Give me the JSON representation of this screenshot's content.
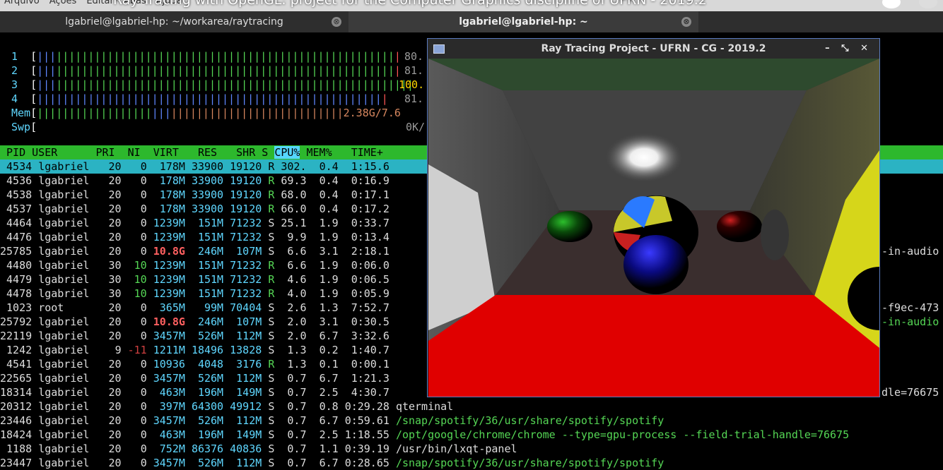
{
  "top_menu": [
    "Arquivo",
    "Ações",
    "Editar",
    "Abas",
    "Ajuda"
  ],
  "video_title": "Ray Tracing with OpenGL: project for the Computer Graphics discipline of UFRN - 2019.2",
  "tabs": [
    {
      "label": "lgabriel@lgabriel-hp: ~/workarea/raytracing",
      "close": "⊗"
    },
    {
      "label": "lgabriel@lgabriel-hp: ~",
      "close": "⊗"
    }
  ],
  "meters": {
    "cpu": [
      {
        "num": "1",
        "pct": "80."
      },
      {
        "num": "2",
        "pct": "81."
      },
      {
        "num": "3",
        "pct": "100."
      },
      {
        "num": "4",
        "pct": "81."
      }
    ],
    "mem": {
      "label": "Mem",
      "value": "2.38G/7.6"
    },
    "swp": {
      "label": "Swp",
      "value": "0K/"
    }
  },
  "table": {
    "header": " PID USER      PRI  NI  VIRT   RES   SHR S CPU% MEM%   TIME+",
    "sort_col": "CPU%",
    "rows": [
      {
        "pid": " 4534",
        "user": "lgabriel",
        "pri": "20",
        "ni": "0",
        "virt": "178M",
        "res": "33900",
        "shr": "19120",
        "s": "R",
        "cpu": "302.",
        "mem": "0.4",
        "time": "1:15.6",
        "cmd": "",
        "sel": true
      },
      {
        "pid": " 4536",
        "user": "lgabriel",
        "pri": "20",
        "ni": "0",
        "virt": "178M",
        "res": "33900",
        "shr": "19120",
        "s": "R",
        "cpu": "69.3",
        "mem": "0.4",
        "time": "0:16.9",
        "cmd": ""
      },
      {
        "pid": " 4538",
        "user": "lgabriel",
        "pri": "20",
        "ni": "0",
        "virt": "178M",
        "res": "33900",
        "shr": "19120",
        "s": "R",
        "cpu": "68.0",
        "mem": "0.4",
        "time": "0:17.1",
        "cmd": ""
      },
      {
        "pid": " 4537",
        "user": "lgabriel",
        "pri": "20",
        "ni": "0",
        "virt": "178M",
        "res": "33900",
        "shr": "19120",
        "s": "R",
        "cpu": "66.0",
        "mem": "0.4",
        "time": "0:17.2",
        "cmd": ""
      },
      {
        "pid": " 4464",
        "user": "lgabriel",
        "pri": "20",
        "ni": "0",
        "virt": "1239M",
        "res": "151M",
        "shr": "71232",
        "s": "S",
        "cpu": "25.1",
        "mem": "1.9",
        "time": "0:33.7",
        "cmd": ""
      },
      {
        "pid": " 4476",
        "user": "lgabriel",
        "pri": "20",
        "ni": "0",
        "virt": "1239M",
        "res": "151M",
        "shr": "71232",
        "s": "S",
        "cpu": "9.9",
        "mem": "1.9",
        "time": "0:13.4",
        "cmd": ""
      },
      {
        "pid": "25785",
        "user": "lgabriel",
        "pri": "20",
        "ni": "0",
        "virt": "10.8G",
        "res": "246M",
        "shr": "107M",
        "s": "S",
        "cpu": "6.6",
        "mem": "3.1",
        "time": "2:18.1",
        "cmd": "",
        "bigvirt": true
      },
      {
        "pid": " 4480",
        "user": "lgabriel",
        "pri": "30",
        "ni": "10",
        "virt": "1239M",
        "res": "151M",
        "shr": "71232",
        "s": "R",
        "cpu": "6.6",
        "mem": "1.9",
        "time": "0:06.0",
        "cmd": ""
      },
      {
        "pid": " 4479",
        "user": "lgabriel",
        "pri": "30",
        "ni": "10",
        "virt": "1239M",
        "res": "151M",
        "shr": "71232",
        "s": "R",
        "cpu": "4.6",
        "mem": "1.9",
        "time": "0:06.5",
        "cmd": ""
      },
      {
        "pid": " 4478",
        "user": "lgabriel",
        "pri": "30",
        "ni": "10",
        "virt": "1239M",
        "res": "151M",
        "shr": "71232",
        "s": "R",
        "cpu": "4.0",
        "mem": "1.9",
        "time": "0:05.9",
        "cmd": ""
      },
      {
        "pid": " 1023",
        "user": "root",
        "pri": "20",
        "ni": "0",
        "virt": "365M",
        "res": "99M",
        "shr": "70404",
        "s": "S",
        "cpu": "2.6",
        "mem": "1.3",
        "time": "7:52.7",
        "cmd": ""
      },
      {
        "pid": "25792",
        "user": "lgabriel",
        "pri": "20",
        "ni": "0",
        "virt": "10.8G",
        "res": "246M",
        "shr": "107M",
        "s": "S",
        "cpu": "2.0",
        "mem": "3.1",
        "time": "0:30.5",
        "cmd": "",
        "bigvirt": true
      },
      {
        "pid": "22119",
        "user": "lgabriel",
        "pri": "20",
        "ni": "0",
        "virt": "3457M",
        "res": "526M",
        "shr": "112M",
        "s": "S",
        "cpu": "2.0",
        "mem": "6.7",
        "time": "3:32.6",
        "cmd": ""
      },
      {
        "pid": " 1242",
        "user": "lgabriel",
        "pri": "9",
        "ni": "-11",
        "virt": "1211M",
        "res": "18496",
        "shr": "13828",
        "s": "S",
        "cpu": "1.3",
        "mem": "0.2",
        "time": "1:40.7",
        "cmd": ""
      },
      {
        "pid": " 4541",
        "user": "lgabriel",
        "pri": "20",
        "ni": "0",
        "virt": "10936",
        "res": "4048",
        "shr": "3176",
        "s": "R",
        "cpu": "1.3",
        "mem": "0.1",
        "time": "0:00.1",
        "cmd": ""
      },
      {
        "pid": "22565",
        "user": "lgabriel",
        "pri": "20",
        "ni": "0",
        "virt": "3457M",
        "res": "526M",
        "shr": "112M",
        "s": "S",
        "cpu": "0.7",
        "mem": "6.7",
        "time": "1:21.3",
        "cmd": ""
      },
      {
        "pid": "18314",
        "user": "lgabriel",
        "pri": "20",
        "ni": "0",
        "virt": "463M",
        "res": "196M",
        "shr": "149M",
        "s": "S",
        "cpu": "0.7",
        "mem": "2.5",
        "time": "4:30.7",
        "cmd": ""
      },
      {
        "pid": "20312",
        "user": "lgabriel",
        "pri": "20",
        "ni": "0",
        "virt": "397M",
        "res": "64300",
        "shr": "49912",
        "s": "S",
        "cpu": "0.7",
        "mem": "0.8",
        "time": "0:29.28",
        "cmd": "qterminal",
        "cmdcolor": "w"
      },
      {
        "pid": "23446",
        "user": "lgabriel",
        "pri": "20",
        "ni": "0",
        "virt": "3457M",
        "res": "526M",
        "shr": "112M",
        "s": "S",
        "cpu": "0.7",
        "mem": "6.7",
        "time": "0:59.61",
        "cmd": "/snap/spotify/36/usr/share/spotify/spotify",
        "cmdcolor": "g"
      },
      {
        "pid": "18424",
        "user": "lgabriel",
        "pri": "20",
        "ni": "0",
        "virt": "463M",
        "res": "196M",
        "shr": "149M",
        "s": "S",
        "cpu": "0.7",
        "mem": "2.5",
        "time": "1:18.55",
        "cmd": "/opt/google/chrome/chrome --type=gpu-process --field-trial-handle=76675",
        "cmdcolor": "g"
      },
      {
        "pid": " 1188",
        "user": "lgabriel",
        "pri": "20",
        "ni": "0",
        "virt": "752M",
        "res": "86376",
        "shr": "40836",
        "s": "S",
        "cpu": "0.7",
        "mem": "1.1",
        "time": "0:39.19",
        "cmd": "/usr/bin/lxqt-panel",
        "cmdcolor": "w"
      },
      {
        "pid": "23447",
        "user": "lgabriel",
        "pri": "20",
        "ni": "0",
        "virt": "3457M",
        "res": "526M",
        "shr": "112M",
        "s": "S",
        "cpu": "0.7",
        "mem": "6.7",
        "time": "0:28.65",
        "cmd": "/snap/spotify/36/usr/share/spotify/spotify",
        "cmdcolor": "g"
      }
    ]
  },
  "right_fragments": {
    "r1": "-in-audio",
    "r2": "-f9ec-473",
    "r3": "-in-audio",
    "r4": "dle=76675"
  },
  "app_window": {
    "title": "Ray Tracing Project - UFRN - CG - 2019.2",
    "buttons": "– ⤡ ✕"
  },
  "colors": {
    "header_bg": "#2db82d",
    "selected_row": "#2bb3c3",
    "accent": "#5a7bbf"
  }
}
